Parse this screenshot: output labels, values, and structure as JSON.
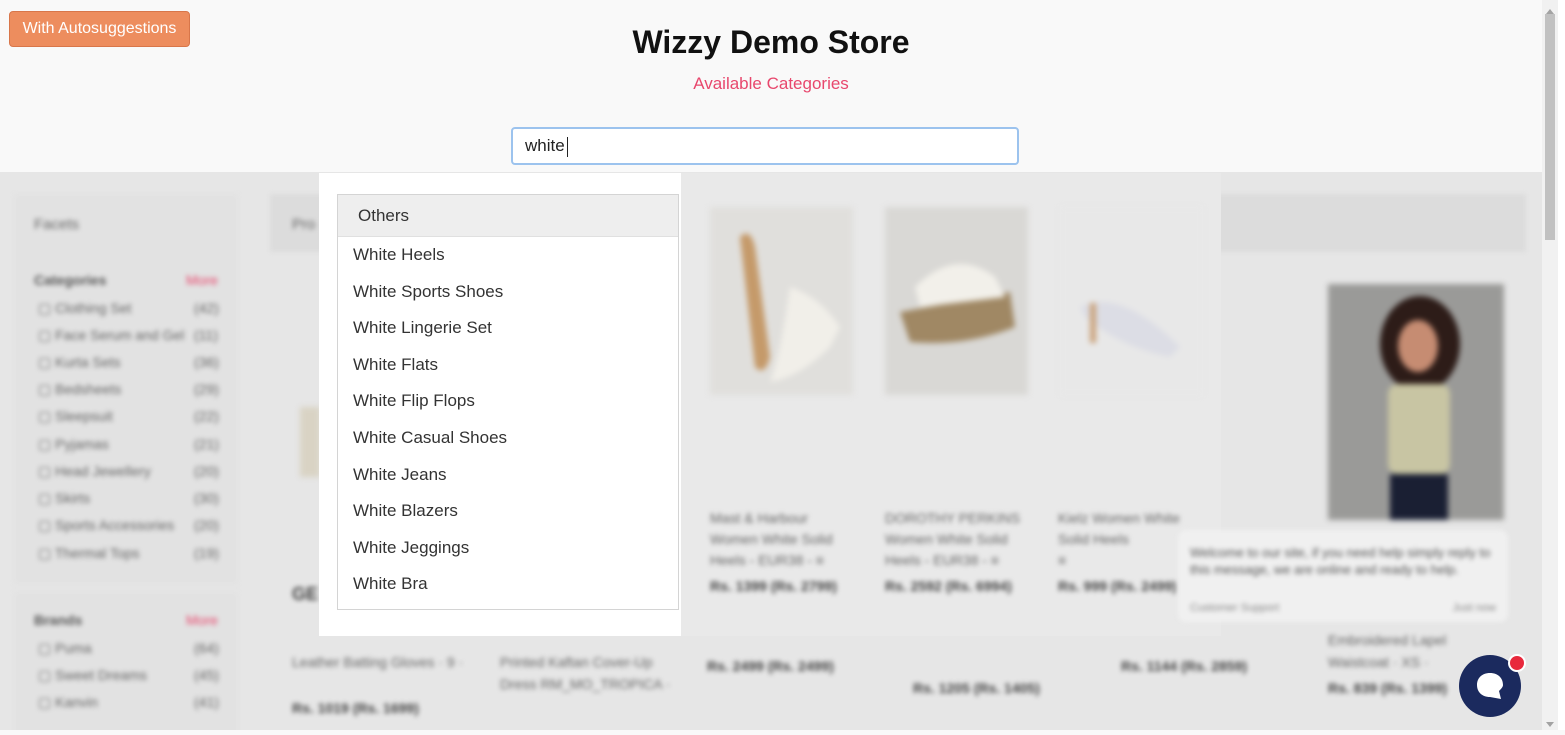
{
  "header": {
    "mode_button": "With Autosuggestions",
    "title": "Wizzy Demo Store",
    "subtitle": "Available Categories"
  },
  "search": {
    "value": "white"
  },
  "suggestions": {
    "section": "Others",
    "items": [
      "White Heels",
      "White Sports Shoes",
      "White Lingerie Set",
      "White Flats",
      "White Flip Flops",
      "White Casual Shoes",
      "White Jeans",
      "White Blazers",
      "White Jeggings",
      "White Bra"
    ]
  },
  "background": {
    "facets_title": "Facets",
    "products_title": "Pro",
    "categories_heading": "Categories",
    "brands_heading": "Brands",
    "more_label": "More",
    "categories": [
      {
        "label": "Clothing Set",
        "count": "(42)"
      },
      {
        "label": "Face Serum and Gel",
        "count": "(11)"
      },
      {
        "label": "Kurta Sets",
        "count": "(36)"
      },
      {
        "label": "Bedsheets",
        "count": "(29)"
      },
      {
        "label": "Sleepsuit",
        "count": "(22)"
      },
      {
        "label": "Pyjamas",
        "count": "(21)"
      },
      {
        "label": "Head Jewellery",
        "count": "(20)"
      },
      {
        "label": "Skirts",
        "count": "(30)"
      },
      {
        "label": "Sports Accessories",
        "count": "(20)"
      },
      {
        "label": "Thermal Tops",
        "count": "(19)"
      }
    ],
    "brands": [
      {
        "label": "Puma",
        "count": "(64)"
      },
      {
        "label": "Sweet Dreams",
        "count": "(45)"
      },
      {
        "label": "Kanvin",
        "count": "(41)"
      }
    ],
    "products": [
      {
        "line1": "Mast & Harbour",
        "line2": "Women White Solid",
        "line3": "Heels - EUR38 - ≡",
        "price": "Rs. 1399 (Rs. 2799)"
      },
      {
        "line1": "DOROTHY PERKINS",
        "line2": "Women White Solid",
        "line3": "Heels - EUR38 - ≡",
        "price": "Rs. 2592 (Rs. 6994)"
      },
      {
        "line1": "Kielz Women White",
        "line2": "Solid Heels",
        "line3": "≡",
        "price": "Rs. 999 (Rs. 2499)"
      }
    ],
    "row2_prices": [
      "Rs. 1019 (Rs. 1699)",
      "Rs. 2499 (Rs. 2499)",
      "Rs. 1205 (Rs. 1405)",
      "Rs. 1144 (Rs. 2859)",
      "Rs. 839 (Rs. 1399)"
    ],
    "row2_text": [
      "Leather Batting Gloves · 9 ·",
      "Printed Kaftan Cover-Up",
      "Dress RM_MO_TROPICA ·",
      "Embroidered Lapel",
      "Waistcoat · XS ·"
    ],
    "chat_message": "Welcome to our site, if you need help simply reply to this message, we are online and ready to help.",
    "chat_from": "Customer Support",
    "chat_time": "Just now"
  },
  "colors": {
    "accent_button": "#ed8d5e",
    "subtitle": "#e8476d",
    "chat_button": "#1b2a5e"
  }
}
